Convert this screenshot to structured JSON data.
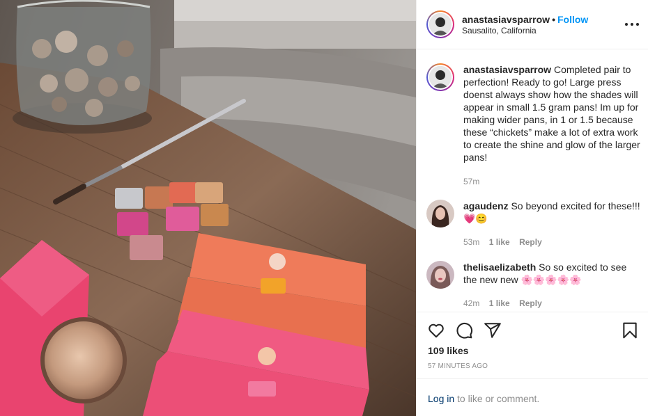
{
  "post": {
    "photo_icon": "post-photo",
    "header": {
      "username": "anastasiavsparrow",
      "separator": "•",
      "follow_label": "Follow",
      "location": "Sausalito, California",
      "more_icon": "more-options-icon"
    },
    "caption": {
      "username": "anastasiavsparrow",
      "text": "Completed pair to perfection! Ready to go! Large press doenst always show how the shades will appear in small 1.5 gram pans! Im up for making wider pans, in 1 or 1.5 because these “chickets” make a lot of extra work to create the shine and glow of the larger pans!",
      "time": "57m"
    },
    "comments": [
      {
        "username": "agaudenz",
        "text": "So beyond excited for these!!! 💗😊",
        "time": "53m",
        "likes": "1 like",
        "reply_label": "Reply"
      },
      {
        "username": "thelisaelizabeth",
        "text": "So so excited to see the new new 🌸🌸🌸🌸🌸",
        "time": "42m",
        "likes": "1 like",
        "reply_label": "Reply"
      }
    ],
    "actions": {
      "icons": [
        "heart-icon",
        "comment-icon",
        "share-icon",
        "bookmark-icon"
      ],
      "likes": "109 likes",
      "posted_ago": "57 MINUTES AGO"
    },
    "login_prompt": {
      "link_label": "Log in",
      "rest": " to like or comment."
    }
  },
  "colors": {
    "link_blue": "#0095f6",
    "login_blue": "#00376b",
    "muted": "#8e8e8e",
    "text": "#262626"
  }
}
